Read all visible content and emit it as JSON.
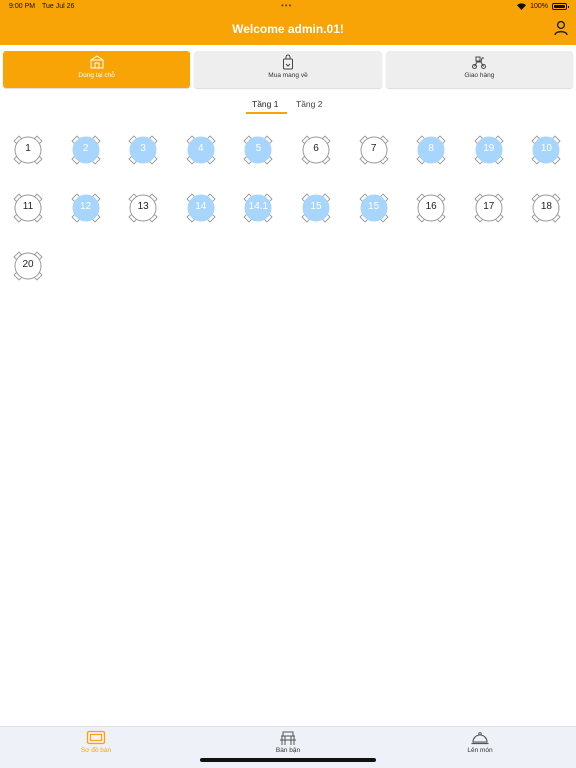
{
  "status_bar": {
    "time": "9:00 PM",
    "date": "Tue Jul 26",
    "battery": "100%"
  },
  "header": {
    "title": "Welcome admin.01!"
  },
  "modes": [
    {
      "label": "Dùng tại chỗ",
      "active": true
    },
    {
      "label": "Mua mang về",
      "active": false
    },
    {
      "label": "Giao hàng",
      "active": false
    }
  ],
  "floors": [
    {
      "label": "Tầng 1",
      "active": true
    },
    {
      "label": "Tầng 2",
      "active": false
    }
  ],
  "tables": [
    {
      "label": "1",
      "busy": false
    },
    {
      "label": "2",
      "busy": true
    },
    {
      "label": "3",
      "busy": true
    },
    {
      "label": "4",
      "busy": true
    },
    {
      "label": "5",
      "busy": true
    },
    {
      "label": "6",
      "busy": false
    },
    {
      "label": "7",
      "busy": false
    },
    {
      "label": "8",
      "busy": true
    },
    {
      "label": "19",
      "busy": true
    },
    {
      "label": "10",
      "busy": true
    },
    {
      "label": "11",
      "busy": false
    },
    {
      "label": "12",
      "busy": true
    },
    {
      "label": "13",
      "busy": false
    },
    {
      "label": "14",
      "busy": true
    },
    {
      "label": "14.1",
      "busy": true
    },
    {
      "label": "15",
      "busy": true
    },
    {
      "label": "15",
      "busy": true
    },
    {
      "label": "16",
      "busy": false
    },
    {
      "label": "17",
      "busy": false
    },
    {
      "label": "18",
      "busy": false
    },
    {
      "label": "20",
      "busy": false
    }
  ],
  "tab_bar": [
    {
      "label": "Sơ đồ bàn",
      "active": true,
      "icon": "floor-plan-icon"
    },
    {
      "label": "Bàn bận",
      "active": false,
      "icon": "busy-table-icon"
    },
    {
      "label": "Lên món",
      "active": false,
      "icon": "serving-cloche-icon"
    }
  ],
  "colors": {
    "accent": "#f9a406",
    "busy_table": "#a8d5fb",
    "tab_bar_bg": "#eef1f7"
  }
}
